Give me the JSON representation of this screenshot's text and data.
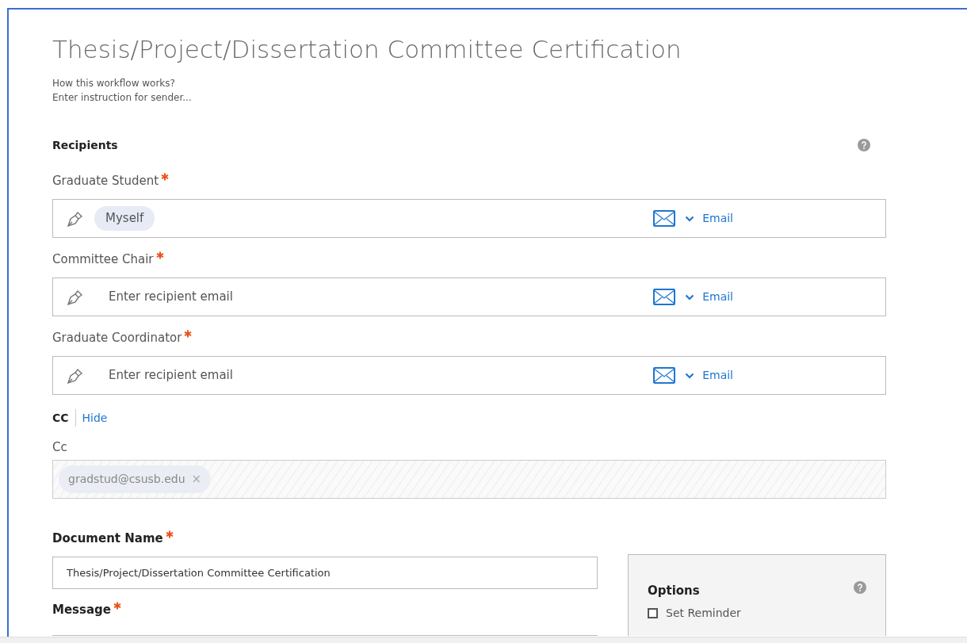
{
  "title": "Thesis/Project/Dissertation Committee Certification",
  "help_links": [
    "How this workflow works?",
    "Enter instruction for sender..."
  ],
  "recipients": {
    "heading": "Recipients",
    "items": [
      {
        "label": "Graduate Student",
        "required": true,
        "kind": "chip",
        "value": "Myself",
        "method": "Email"
      },
      {
        "label": "Committee Chair",
        "required": true,
        "kind": "empty",
        "placeholder": "Enter recipient email",
        "method": "Email"
      },
      {
        "label": "Graduate Coordinator",
        "required": true,
        "kind": "empty",
        "placeholder": "Enter recipient email",
        "method": "Email"
      }
    ]
  },
  "cc": {
    "heading": "CC",
    "toggle": "Hide",
    "label": "Cc",
    "disabled": true,
    "chips": [
      "gradstud@csusb.edu"
    ],
    "remove": "×"
  },
  "document_name": {
    "label": "Document Name",
    "required": true,
    "value": "Thesis/Project/Dissertation Committee Certification"
  },
  "message": {
    "label": "Message",
    "required": true
  },
  "options": {
    "heading": "Options",
    "items": [
      {
        "label": "Set Reminder",
        "checked": false
      }
    ]
  }
}
